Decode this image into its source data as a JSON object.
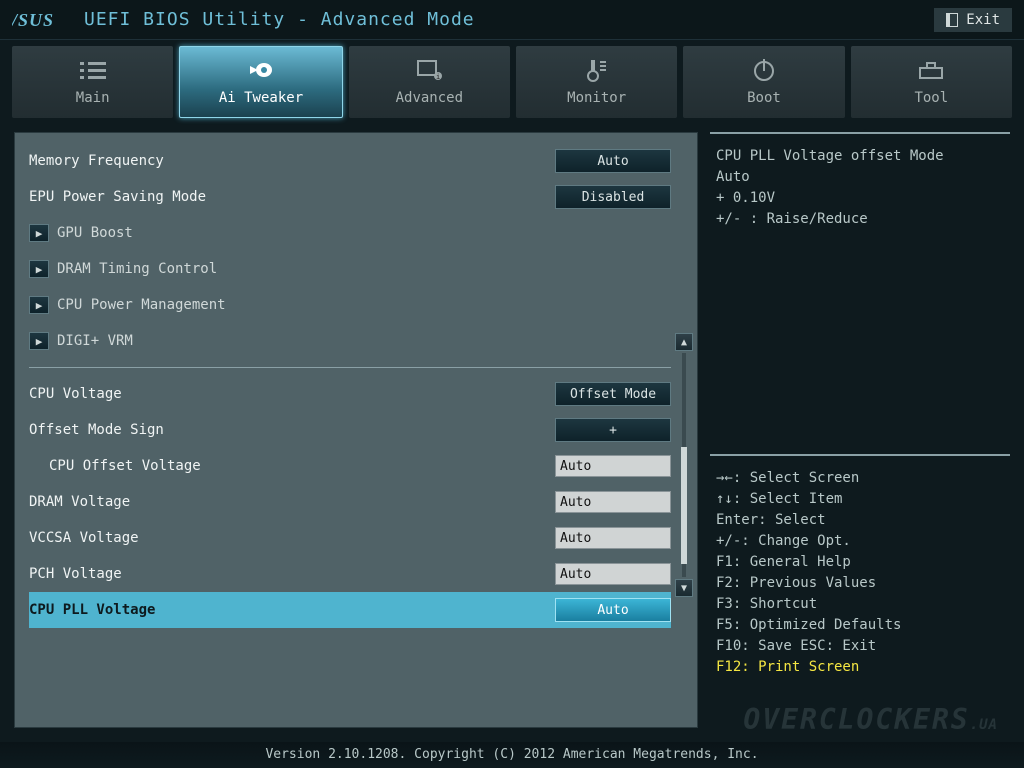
{
  "header": {
    "brand": "/SUS",
    "title": "UEFI BIOS Utility - Advanced Mode",
    "exit": "Exit"
  },
  "tabs": [
    {
      "label": "Main"
    },
    {
      "label": "Ai Tweaker"
    },
    {
      "label": "Advanced"
    },
    {
      "label": "Monitor"
    },
    {
      "label": "Boot"
    },
    {
      "label": "Tool"
    }
  ],
  "settings": {
    "memory_frequency": {
      "label": "Memory Frequency",
      "value": "Auto"
    },
    "epu_power_saving": {
      "label": "EPU Power Saving Mode",
      "value": "Disabled"
    },
    "gpu_boost": {
      "label": "GPU Boost"
    },
    "dram_timing": {
      "label": "DRAM Timing Control"
    },
    "cpu_power_mgmt": {
      "label": "CPU Power Management"
    },
    "digi_vrm": {
      "label": "DIGI+ VRM"
    },
    "cpu_voltage": {
      "label": "CPU Voltage",
      "value": "Offset Mode"
    },
    "offset_sign": {
      "label": "Offset Mode Sign",
      "value": "+"
    },
    "cpu_offset_voltage": {
      "label": "CPU Offset Voltage",
      "value": "Auto"
    },
    "dram_voltage": {
      "label": "DRAM Voltage",
      "value": "Auto"
    },
    "vccsa_voltage": {
      "label": "VCCSA Voltage",
      "value": "Auto"
    },
    "pch_voltage": {
      "label": "PCH Voltage",
      "value": "Auto"
    },
    "cpu_pll_voltage": {
      "label": "CPU PLL Voltage",
      "value": "Auto"
    }
  },
  "info": {
    "line1": "CPU PLL Voltage offset Mode",
    "line2": "Auto",
    "line3": "+ 0.10V",
    "line4": "+/- : Raise/Reduce"
  },
  "help": {
    "l1": "→←: Select Screen",
    "l2": "↑↓: Select Item",
    "l3": "Enter: Select",
    "l4": "+/-: Change Opt.",
    "l5": "F1: General Help",
    "l6": "F2: Previous Values",
    "l7": "F3: Shortcut",
    "l8": "F5: Optimized Defaults",
    "l9": "F10: Save  ESC: Exit",
    "l10": "F12: Print Screen"
  },
  "footer": "Version 2.10.1208. Copyright (C) 2012 American Megatrends, Inc.",
  "watermark": {
    "main": "OVERCLOCKERS",
    "suffix": ".UA"
  }
}
